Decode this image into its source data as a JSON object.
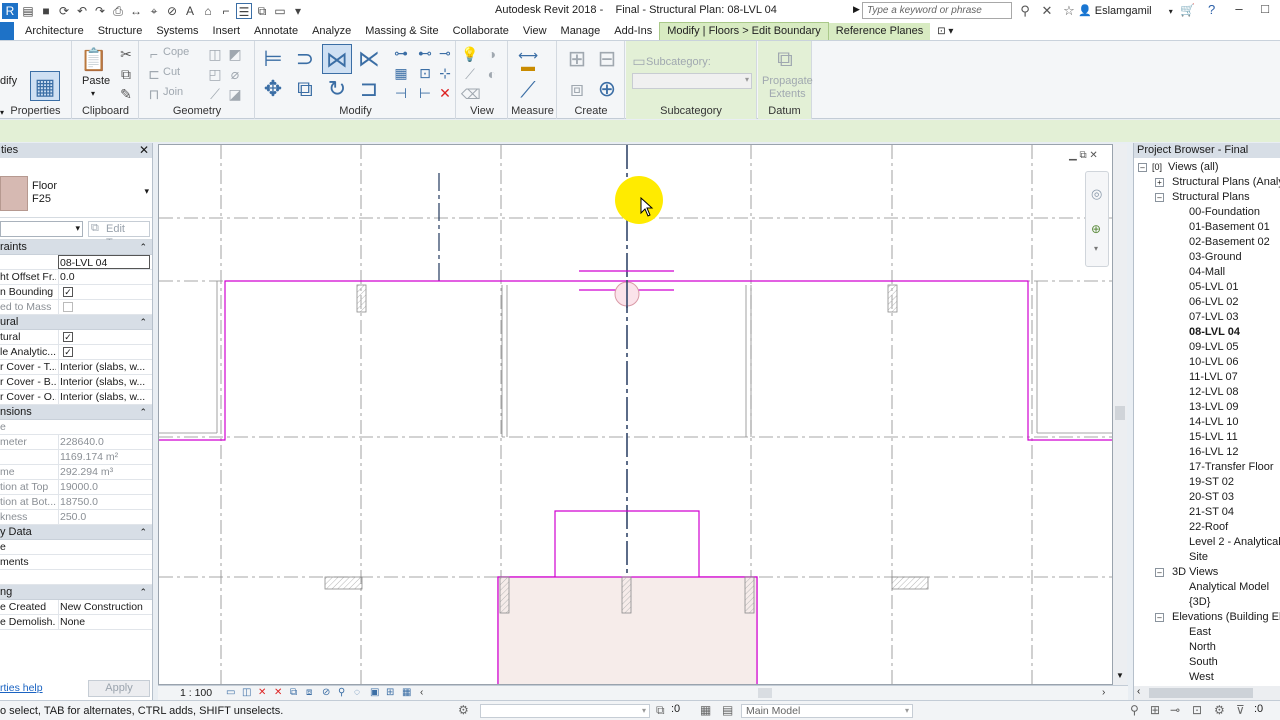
{
  "titlebar": {
    "app_title": "Autodesk Revit 2018 -",
    "doc_title": "Final - Structural Plan: 08-LVL 04",
    "search_placeholder": "Type a keyword or phrase",
    "user": "Eslamgamil"
  },
  "tabs": [
    "Architecture",
    "Structure",
    "Systems",
    "Insert",
    "Annotate",
    "Analyze",
    "Massing & Site",
    "Collaborate",
    "View",
    "Manage",
    "Add-Ins",
    "Modify | Floors > Edit Boundary",
    "Reference Planes"
  ],
  "ribbon": {
    "panels": {
      "properties": "Properties",
      "clipboard": "Clipboard",
      "geometry": "Geometry",
      "modify": "Modify",
      "view": "View",
      "measure": "Measure",
      "create": "Create",
      "subcategory": "Subcategory",
      "datum": "Datum"
    },
    "clipboard_paste": "Paste",
    "geometry_cope": "Cope",
    "geometry_cut": "Cut",
    "geometry_join": "Join",
    "subcategory_label": "Subcategory:",
    "propagate_1": "Propagate",
    "propagate_2": "Extents",
    "left_stub": "dify"
  },
  "properties": {
    "title": "ties",
    "type_name_1": "Floor",
    "type_name_2": "F25",
    "edit_type": "Edit Type",
    "groups": {
      "constraints": "raints",
      "structural": "ural",
      "dimensions": "nsions",
      "identity": "y Data",
      "phasing": "ng"
    },
    "constraints": [
      {
        "k": "",
        "v": "08-LVL 04"
      },
      {
        "k": "ht Offset Fr...",
        "v": "0.0"
      },
      {
        "k": "n Bounding",
        "v": ""
      },
      {
        "k": "ed to Mass",
        "v": ""
      }
    ],
    "structural": [
      {
        "k": "tural",
        "v": ""
      },
      {
        "k": "le Analytic...",
        "v": ""
      },
      {
        "k": "r Cover - T...",
        "v": "Interior (slabs, w..."
      },
      {
        "k": "r Cover - B...",
        "v": "Interior (slabs, w..."
      },
      {
        "k": "r Cover - O...",
        "v": "Interior (slabs, w..."
      }
    ],
    "dimensions": [
      {
        "k": "e",
        "v": ""
      },
      {
        "k": "meter",
        "v": "228640.0"
      },
      {
        "k": "",
        "v": "1169.174 m²"
      },
      {
        "k": "me",
        "v": "292.294 m³"
      },
      {
        "k": "tion at Top",
        "v": "19000.0"
      },
      {
        "k": "tion at Bot...",
        "v": "18750.0"
      },
      {
        "k": "kness",
        "v": "250.0"
      }
    ],
    "identity": [
      {
        "k": "e",
        "v": ""
      },
      {
        "k": "ments",
        "v": ""
      },
      {
        "k": "",
        "v": ""
      }
    ],
    "phasing": [
      {
        "k": "e Created",
        "v": "New Construction"
      },
      {
        "k": "e Demolish...",
        "v": "None"
      }
    ],
    "help": "rties help",
    "apply": "Apply"
  },
  "viewbar": {
    "scale": "1 : 100"
  },
  "browser": {
    "title": "Project Browser - Final",
    "views_all": "Views (all)",
    "struct_analytical": "Structural Plans (Analytic",
    "struct_plans": "Structural Plans",
    "plans": [
      "00-Foundation",
      "01-Basement 01",
      "02-Basement 02",
      "03-Ground",
      "04-Mall",
      "05-LVL 01",
      "06-LVL 02",
      "07-LVL 03",
      "08-LVL 04",
      "09-LVL 05",
      "10-LVL 06",
      "11-LVL 07",
      "12-LVL 08",
      "13-LVL 09",
      "14-LVL 10",
      "15-LVL 11",
      "16-LVL 12",
      "17-Transfer Floor",
      "19-ST 02",
      "20-ST 03",
      "21-ST 04",
      "22-Roof",
      "Level 2 - Analytical",
      "Site"
    ],
    "views_3d": "3D Views",
    "views_3d_items": [
      "Analytical Model",
      "{3D}"
    ],
    "elevations": "Elevations (Building Elev",
    "elevation_items": [
      "East",
      "North",
      "South",
      "West"
    ]
  },
  "status": {
    "hint": "o select, TAB for alternates, CTRL adds, SHIFT unselects.",
    "filter_count": ":0",
    "model": "Main Model"
  },
  "colors": {
    "accent_tab": "#1e72c7",
    "contextual_tab": "#d8ebc2",
    "sketch_line": "#d000d0",
    "grid_axis": "#33476a"
  }
}
